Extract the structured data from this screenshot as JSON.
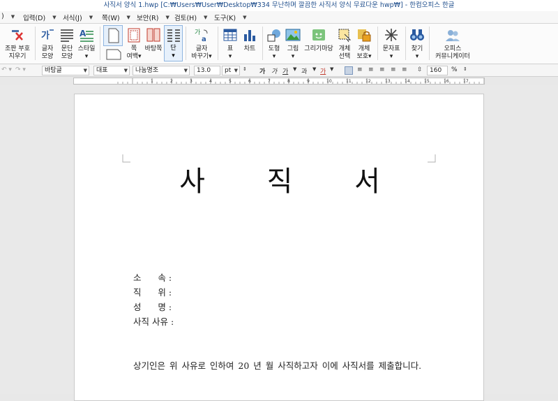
{
  "window": {
    "title": "사직서 양식 1.hwp [C:₩Users₩User₩Desktop₩334 무난하며 깔끔한 사직서 양식 무료다운 hwp₩] - 한컴오피스 한글"
  },
  "menu": {
    "items": [
      {
        "label": ")"
      },
      {
        "label": "입력(D)"
      },
      {
        "label": "서식(J)"
      },
      {
        "label": "쪽(W)"
      },
      {
        "label": "보안(R)"
      },
      {
        "label": "검토(H)"
      },
      {
        "label": "도구(K)"
      }
    ]
  },
  "ribbon": {
    "buttons": [
      {
        "id": "clear-format",
        "l1": "조판 부호",
        "l2": "지우기"
      },
      {
        "id": "char-shape",
        "l1": "글자",
        "l2": "모양"
      },
      {
        "id": "para-shape",
        "l1": "문단",
        "l2": "모양"
      },
      {
        "id": "style",
        "l1": "스타일",
        "l2": "▾"
      },
      {
        "id": "page-margin",
        "l1": "쪽",
        "l2": "여백▾"
      },
      {
        "id": "background",
        "l1": "바탕쪽",
        "l2": ""
      },
      {
        "id": "column",
        "l1": "단",
        "l2": "▾"
      },
      {
        "id": "char-replace",
        "l1": "글자",
        "l2": "바꾸기▾"
      },
      {
        "id": "table",
        "l1": "표",
        "l2": "▾"
      },
      {
        "id": "chart",
        "l1": "차트",
        "l2": ""
      },
      {
        "id": "shape",
        "l1": "도형",
        "l2": "▾"
      },
      {
        "id": "picture",
        "l1": "그림",
        "l2": "▾"
      },
      {
        "id": "draw-market",
        "l1": "그리기마당",
        "l2": ""
      },
      {
        "id": "object-select",
        "l1": "개체",
        "l2": "선택"
      },
      {
        "id": "object-protect",
        "l1": "개체",
        "l2": "보호▾"
      },
      {
        "id": "symbol",
        "l1": "문자표",
        "l2": "▾"
      },
      {
        "id": "find",
        "l1": "찾기",
        "l2": "▾"
      },
      {
        "id": "office-community",
        "l1": "오피스",
        "l2": "커뮤니케이터"
      }
    ]
  },
  "format_bar": {
    "style": "바탕글",
    "para": "대표",
    "font": "나눔명조",
    "size": "13.0",
    "unit": "pt",
    "zoom": "160",
    "zoom_unit": "%",
    "bold": "가",
    "italic": "가",
    "underline": "가",
    "strike": "과",
    "color": "가"
  },
  "document": {
    "title": "사 직 서",
    "fields": [
      {
        "label": "소      속 :"
      },
      {
        "label": "직      위 :"
      },
      {
        "label": "성      명 :"
      },
      {
        "label": "사직 사유 :"
      }
    ],
    "body": "상기인은 위 사유로 인하여 20  년  월 사직하고자 이에 사직서를 제출합니다."
  },
  "ruler": {
    "ticks": [
      "1",
      "2",
      "3",
      "4",
      "5",
      "6",
      "7",
      "8",
      "9",
      "10",
      "11",
      "12",
      "13",
      "14",
      "15",
      "16",
      "17",
      "18"
    ]
  }
}
